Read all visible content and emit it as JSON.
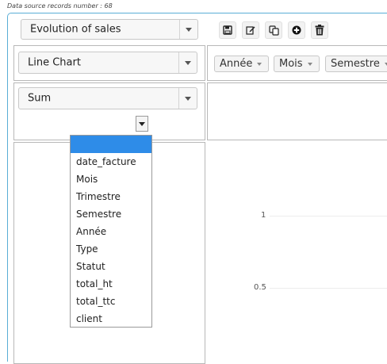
{
  "header": {
    "records_label": "Data source records number : 68"
  },
  "report_select": {
    "value": "Evolution of sales"
  },
  "chart_type_select": {
    "value": "Line Chart"
  },
  "aggregation_select": {
    "value": "Sum"
  },
  "toolbar": {
    "icons": [
      "save-icon",
      "edit-icon",
      "copy-icon",
      "add-icon",
      "delete-icon"
    ]
  },
  "column_fields": [
    {
      "label": "Année"
    },
    {
      "label": "Mois"
    },
    {
      "label": "Semestre"
    }
  ],
  "attribute_dropdown": {
    "selected": "",
    "options": [
      "date_facture",
      "Mois",
      "Trimestre",
      "Semestre",
      "Année",
      "Type",
      "Statut",
      "total_ht",
      "total_ttc",
      "client"
    ]
  },
  "chart_data": {
    "type": "line",
    "y_ticks": [
      "1",
      "0.5"
    ]
  },
  "colors": {
    "accent_border": "#5aaed6",
    "highlight": "#2e8ce8"
  }
}
